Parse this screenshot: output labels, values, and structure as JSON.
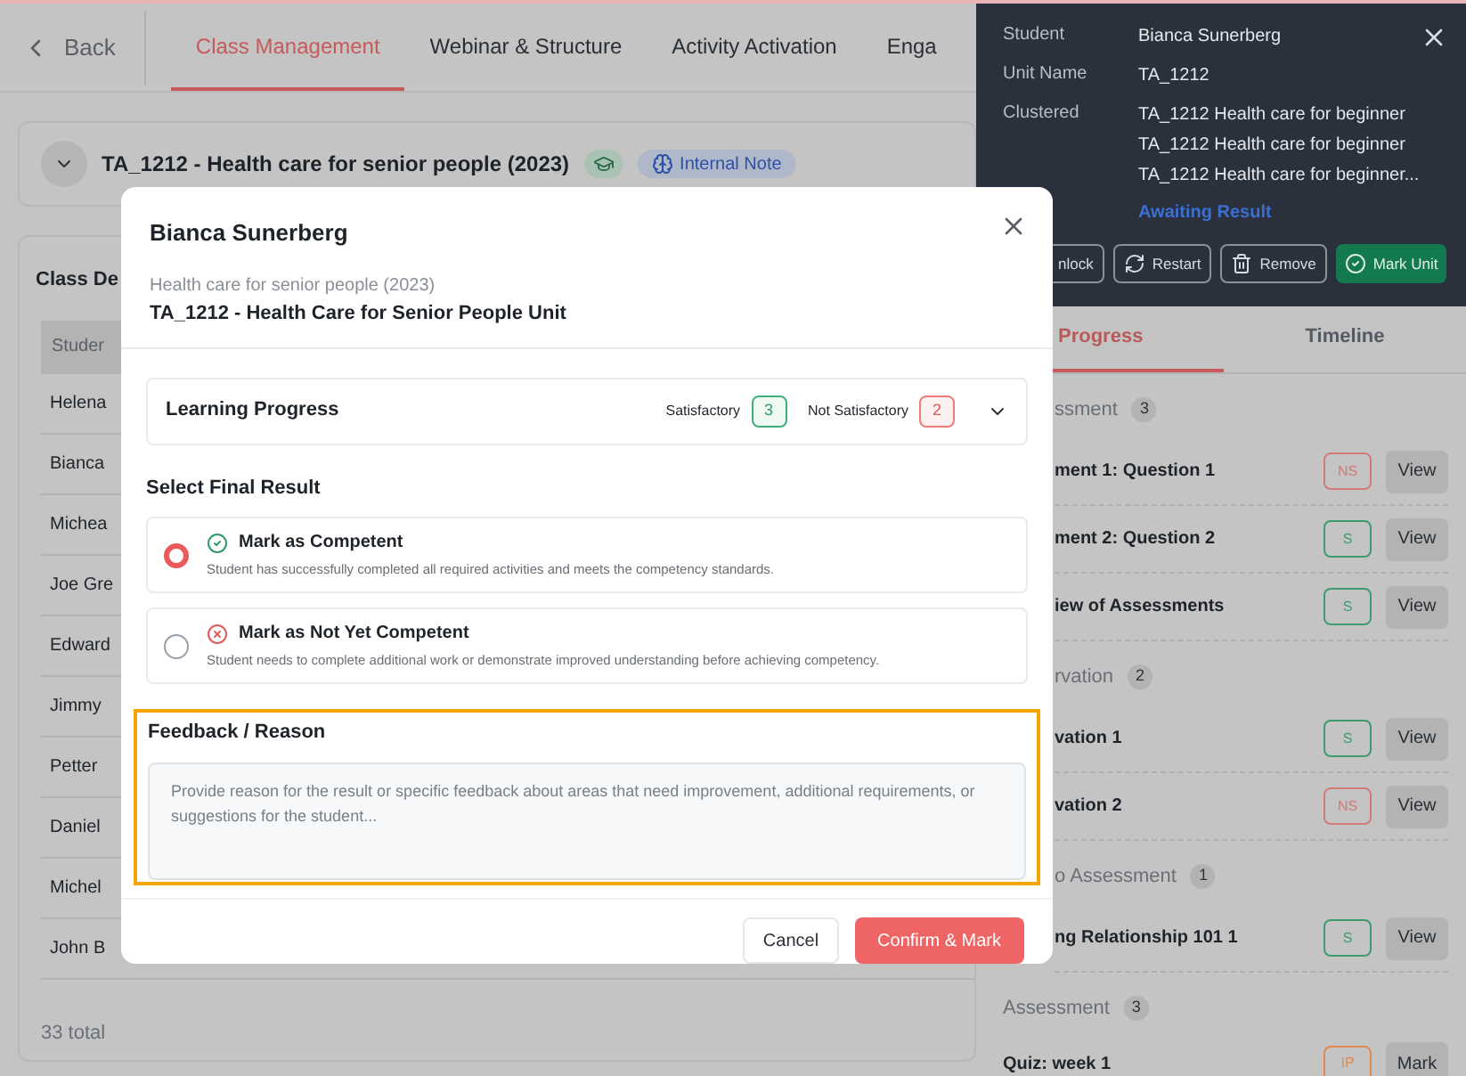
{
  "nav": {
    "back": "Back",
    "tabs": [
      {
        "label": "Class Management",
        "selected": true
      },
      {
        "label": "Webinar & Structure",
        "selected": false
      },
      {
        "label": "Activity Activation",
        "selected": false
      },
      {
        "label": "Enga",
        "selected": false
      }
    ]
  },
  "course": {
    "title": "TA_1212 - Health care for senior people (2023)",
    "note": "Internal Note"
  },
  "class_details": {
    "title": "Class De",
    "header": "Studer",
    "students": [
      "Helena",
      "Bianca",
      "Michea",
      "Joe Gre",
      "Edward",
      "Jimmy",
      "Petter",
      "Daniel",
      "Michel",
      "John B"
    ],
    "total": "33 total"
  },
  "drawer": {
    "fields": [
      {
        "label": "Student",
        "values": [
          "Bianca Sunerberg"
        ]
      },
      {
        "label": "Unit Name",
        "values": [
          "TA_1212"
        ]
      },
      {
        "label": "Clustered",
        "values": [
          "TA_1212 Health care for beginner",
          "TA_1212 Health care for beginner",
          "TA_1212 Health care for beginner..."
        ]
      }
    ],
    "status": "Awaiting Result",
    "actions": [
      {
        "label": "nlock",
        "kind": "plain"
      },
      {
        "label": "Restart",
        "kind": "restart"
      },
      {
        "label": "Remove",
        "kind": "remove"
      },
      {
        "label": "Mark Unit",
        "kind": "primary"
      }
    ],
    "tabs": [
      {
        "label": "Progress",
        "selected": true
      },
      {
        "label": "Timeline",
        "selected": false
      }
    ],
    "sections": [
      {
        "title": "ssment",
        "count": "3",
        "cut": true,
        "items": [
          {
            "name": "ment 1: Question 1",
            "status": "NS",
            "color": "#d27a7a",
            "action": "View"
          },
          {
            "name": "ment 2: Question 2",
            "status": "S",
            "color": "#3f9a6f",
            "action": "View"
          },
          {
            "name": "iew of Assessments",
            "status": "S",
            "color": "#3f9a6f",
            "action": "View"
          }
        ]
      },
      {
        "title": "rvation",
        "count": "2",
        "cut": true,
        "items": [
          {
            "name": "vation 1",
            "status": "S",
            "color": "#3f9a6f",
            "action": "View"
          },
          {
            "name": "vation 2",
            "status": "NS",
            "color": "#d27a7a",
            "action": "View"
          }
        ]
      },
      {
        "title": "o Assessment",
        "count": "1",
        "cut": true,
        "items": [
          {
            "name": "ng Relationship 101 1",
            "status": "S",
            "color": "#3f9a6f",
            "action": "View"
          }
        ]
      },
      {
        "title": "Assessment",
        "count": "3",
        "cut": false,
        "items": [
          {
            "name": "Quiz: week 1",
            "status": "IP",
            "color": "#e08a50",
            "action": "Mark"
          }
        ]
      }
    ]
  },
  "modal": {
    "title": "Bianca Sunerberg",
    "subtitle": "Health care for senior people (2023)",
    "unit": "TA_1212 - Health Care for Senior People Unit",
    "progress": {
      "title": "Learning Progress",
      "satisfactory_label": "Satisfactory",
      "satisfactory": "3",
      "not_satisfactory_label": "Not Satisfactory",
      "not_satisfactory": "2"
    },
    "result_title": "Select Final Result",
    "options": [
      {
        "kind": "competent",
        "label": "Mark as Competent",
        "description": "Student has successfully completed all required activities and meets the competency standards.",
        "selected": true
      },
      {
        "kind": "not_competent",
        "label": "Mark as Not Yet Competent",
        "description": "Student needs to complete additional work or demonstrate improved understanding before achieving competency.",
        "selected": false
      }
    ],
    "feedback": {
      "label": "Feedback / Reason",
      "placeholder": "Provide reason for the result or specific feedback about areas that need improvement, additional requirements, or suggestions for the student..."
    },
    "buttons": {
      "cancel": "Cancel",
      "confirm": "Confirm & Mark"
    }
  }
}
